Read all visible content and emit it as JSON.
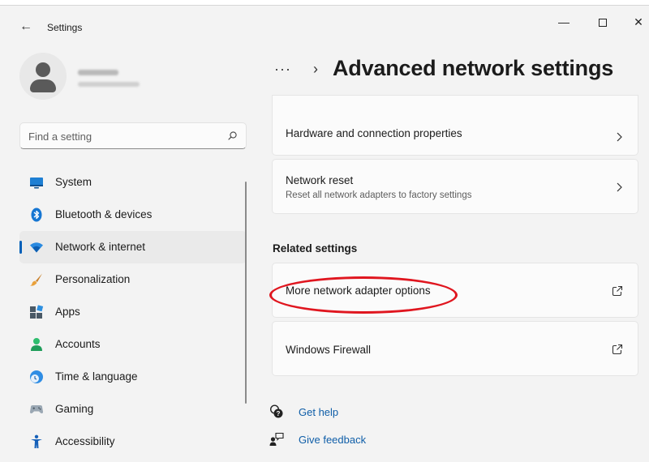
{
  "window": {
    "app_title": "Settings",
    "back_symbol": "←",
    "minimize_symbol": "—",
    "close_symbol": "✕"
  },
  "profile": {
    "avatar_icon": "person-icon"
  },
  "search": {
    "placeholder": "Find a setting",
    "icon": "search-icon"
  },
  "sidebar": {
    "items": [
      {
        "label": "System",
        "icon": "monitor-icon",
        "selected": false
      },
      {
        "label": "Bluetooth & devices",
        "icon": "bluetooth-icon",
        "selected": false
      },
      {
        "label": "Network & internet",
        "icon": "wifi-icon",
        "selected": true
      },
      {
        "label": "Personalization",
        "icon": "brush-icon",
        "selected": false
      },
      {
        "label": "Apps",
        "icon": "apps-icon",
        "selected": false
      },
      {
        "label": "Accounts",
        "icon": "account-icon",
        "selected": false
      },
      {
        "label": "Time & language",
        "icon": "clock-globe-icon",
        "selected": false
      },
      {
        "label": "Gaming",
        "icon": "gamepad-icon",
        "selected": false
      },
      {
        "label": "Accessibility",
        "icon": "accessibility-icon",
        "selected": false
      }
    ]
  },
  "breadcrumb": {
    "more": "···",
    "separator": "›",
    "title": "Advanced network settings"
  },
  "cards": {
    "hardware": {
      "title": "Hardware and connection properties"
    },
    "reset": {
      "title": "Network reset",
      "subtitle": "Reset all network adapters to factory settings"
    },
    "adapter": {
      "title": "More network adapter options"
    },
    "firewall": {
      "title": "Windows Firewall"
    }
  },
  "related": {
    "title": "Related settings"
  },
  "help": {
    "get_help": "Get help",
    "give_feedback": "Give feedback"
  },
  "colors": {
    "accent": "#005fb8",
    "link": "#0f5ea8",
    "annotation": "#e0161f",
    "background": "#f3f3f3",
    "card": "#fbfbfb"
  }
}
